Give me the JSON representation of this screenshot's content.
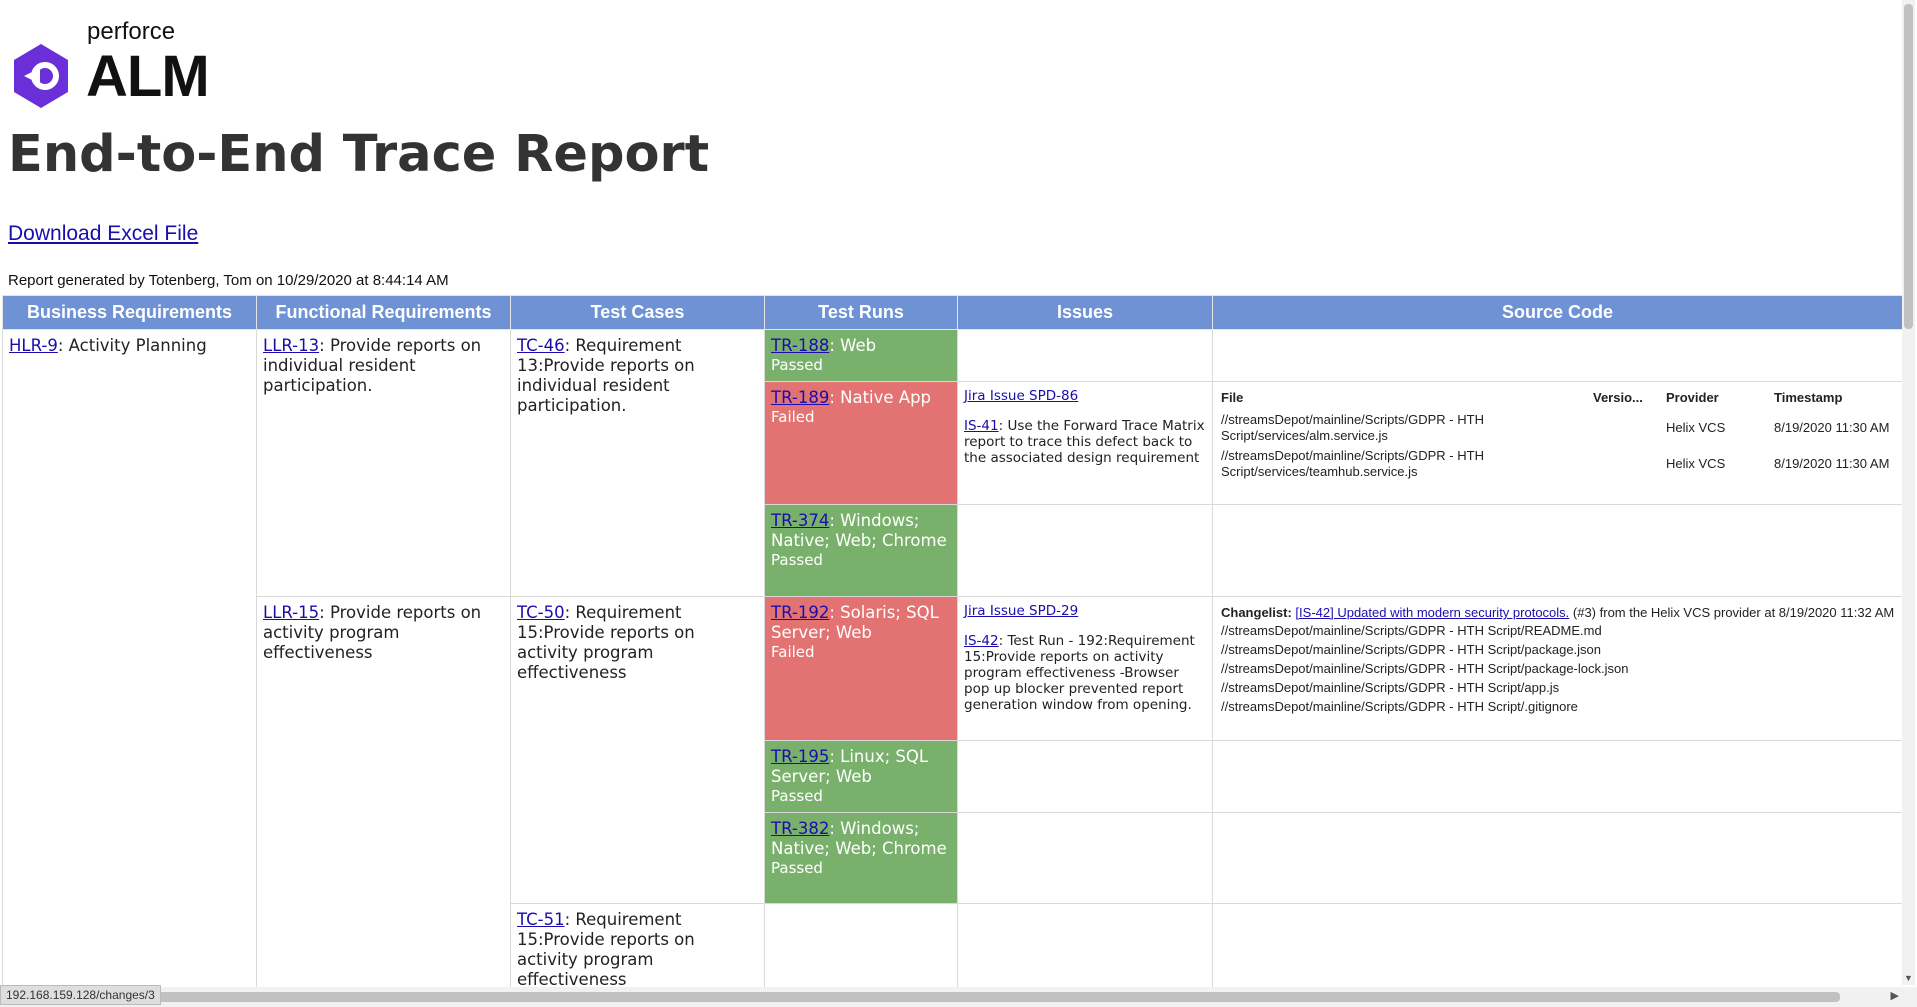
{
  "brand": {
    "small": "perforce",
    "big": "ALM",
    "color": "#6a2fd9"
  },
  "report": {
    "title": "End-to-End Trace Report",
    "download_label": "Download Excel File",
    "generated_by": "Report generated by Totenberg, Tom on 10/29/2020 at 8:44:14 AM"
  },
  "columns": [
    "Business Requirements",
    "Functional Requirements",
    "Test Cases",
    "Test Runs",
    "Issues",
    "Source Code"
  ],
  "hlr": {
    "id": "HLR-9",
    "text": ": Activity Planning"
  },
  "llr13": {
    "id": "LLR-13",
    "text": ": Provide reports on individual resident participation."
  },
  "llr15": {
    "id": "LLR-15",
    "text": ": Provide reports on activity program effectiveness"
  },
  "tc46": {
    "id": "TC-46",
    "text": ": Requirement 13:Provide reports on individual resident participation."
  },
  "tc50": {
    "id": "TC-50",
    "text": ": Requirement 15:Provide reports on activity program effectiveness"
  },
  "tc51": {
    "id": "TC-51",
    "text": ": Requirement 15:Provide reports on activity program effectiveness"
  },
  "tr188": {
    "id": "TR-188",
    "text": ": Web",
    "status": "Passed"
  },
  "tr189": {
    "id": "TR-189",
    "text": ": Native App",
    "status": "Failed"
  },
  "tr374": {
    "id": "TR-374",
    "text": ": Windows; Native; Web; Chrome",
    "status": "Passed"
  },
  "tr192": {
    "id": "TR-192",
    "text": ": Solaris; SQL Server; Web",
    "status": "Failed"
  },
  "tr195": {
    "id": "TR-195",
    "text": ": Linux; SQL Server; Web",
    "status": "Passed"
  },
  "tr382": {
    "id": "TR-382",
    "text": ": Windows; Native; Web; Chrome",
    "status": "Passed"
  },
  "issue1": {
    "jira": "Jira Issue SPD-86",
    "id": "IS-41",
    "text": ": Use the Forward Trace Matrix report to trace this defect back to the associated design requirement"
  },
  "issue2": {
    "jira": "Jira Issue SPD-29",
    "id": "IS-42",
    "text": ": Test Run - 192:Requirement 15:Provide reports on activity program effectiveness -Browser pop up blocker prevented report generation window from opening."
  },
  "src_headers": {
    "file": "File",
    "version": "Versio...",
    "provider": "Provider",
    "timestamp": "Timestamp"
  },
  "src_rows": [
    {
      "file": "//streamsDepot/mainline/Scripts/GDPR - HTH Script/services/alm.service.js",
      "provider": "Helix VCS",
      "timestamp": "8/19/2020 11:30 AM"
    },
    {
      "file": "//streamsDepot/mainline/Scripts/GDPR - HTH Script/services/teamhub.service.js",
      "provider": "Helix VCS",
      "timestamp": "8/19/2020 11:30 AM"
    }
  ],
  "changelist": {
    "label": "Changelist:",
    "link": "[IS-42] Updated with modern security protocols.",
    "rest": " (#3) from the Helix VCS provider at 8/19/2020 11:32 AM",
    "files": [
      "//streamsDepot/mainline/Scripts/GDPR - HTH Script/README.md",
      "//streamsDepot/mainline/Scripts/GDPR - HTH Script/package.json",
      "//streamsDepot/mainline/Scripts/GDPR - HTH Script/package-lock.json",
      "//streamsDepot/mainline/Scripts/GDPR - HTH Script/app.js",
      "//streamsDepot/mainline/Scripts/GDPR - HTH Script/.gitignore"
    ]
  },
  "status_bar_url": "192.168.159.128/changes/3",
  "colors": {
    "header": "#6f92d4",
    "passed": "#79b16c",
    "failed": "#e37373",
    "link": "#1a0dab"
  }
}
